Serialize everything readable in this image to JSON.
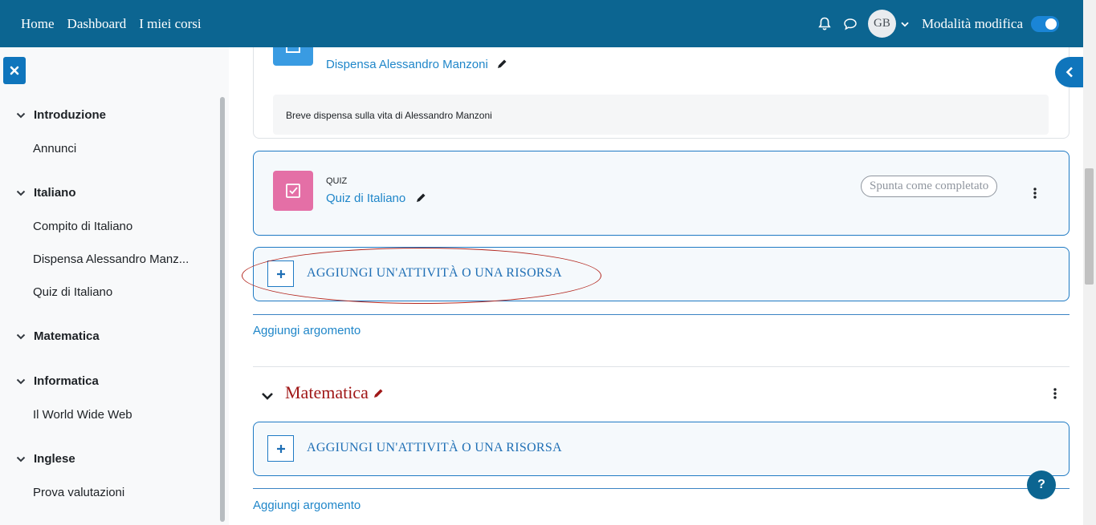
{
  "navbar": {
    "links": [
      "Home",
      "Dashboard",
      "I miei corsi"
    ],
    "user_initials": "GB",
    "edit_mode_label": "Modalità modifica",
    "edit_mode_on": true,
    "color": "#0c6591"
  },
  "course_index": {
    "sections": [
      {
        "title": "Introduzione",
        "items": [
          "Annunci"
        ]
      },
      {
        "title": "Italiano",
        "items": [
          "Compito di Italiano",
          "Dispensa Alessandro Manz...",
          "Quiz di Italiano"
        ]
      },
      {
        "title": "Matematica",
        "items": []
      },
      {
        "title": "Informatica",
        "items": [
          "Il World Wide Web"
        ]
      },
      {
        "title": "Inglese",
        "items": [
          "Prova valutazioni"
        ]
      }
    ]
  },
  "main": {
    "resource_card": {
      "title": "Dispensa Alessandro Manzoni",
      "description": "Breve dispensa sulla vita di Alessandro Manzoni",
      "icon": "file-icon",
      "icon_color": "#399be2"
    },
    "quiz_card": {
      "type_label": "QUIZ",
      "title": "Quiz di Italiano",
      "complete_label": "Spunta come completato",
      "icon": "checkbox-icon",
      "icon_color": "#e46fa6"
    },
    "add_activity_label": "AGGIUNGI UN'ATTIVITÀ O UNA RISORSA",
    "add_topic_label": "Aggiungi argomento",
    "next_section": {
      "title": "Matematica",
      "title_color": "#a01818",
      "add_activity_label": "AGGIUNGI UN'ATTIVITÀ O UNA RISORSA",
      "add_topic_label": "Aggiungi argomento"
    }
  },
  "help_label": "?"
}
